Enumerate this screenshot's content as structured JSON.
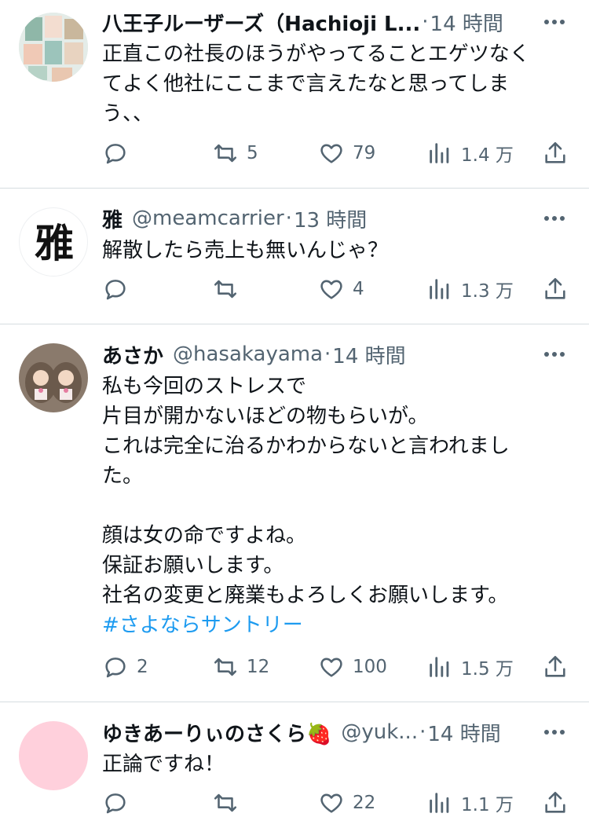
{
  "tweets": [
    {
      "name": "八王子ルーザーズ（Hachioji L...",
      "handle": "",
      "time": "14 時間",
      "lines": [
        "正直この社長のほうがやってることエゲツなく",
        "てよく他社にここまで言えたなと思ってしま",
        "う、、"
      ],
      "hashtag": "",
      "replies": "",
      "retweets": "5",
      "likes": "79",
      "views": "1.4 万",
      "avatar": "photo-collage"
    },
    {
      "name": "雅",
      "handle": "@meamcarrier",
      "time": "13 時間",
      "lines": [
        "解散したら売上も無いんじゃ？"
      ],
      "hashtag": "",
      "replies": "",
      "retweets": "",
      "likes": "4",
      "views": "1.3 万",
      "avatar_text": "雅"
    },
    {
      "name": "あさか",
      "handle": "@hasakayama",
      "time": "14 時間",
      "lines": [
        "私も今回のストレスで",
        "片目が開かないほどの物もらいが。",
        "これは完全に治るかわからないと言われまし",
        "た。",
        "",
        "顔は女の命ですよね。",
        "保証お願いします。",
        "社名の変更と廃業もよろしくお願いします。"
      ],
      "hashtag": "#さよならサントリー",
      "replies": "2",
      "retweets": "12",
      "likes": "100",
      "views": "1.5 万",
      "avatar": "plush-dolls"
    },
    {
      "name": "ゆきあーりぃのさくら🍓",
      "handle": "@yuk...",
      "time": "14 時間",
      "lines": [
        "正論ですね！"
      ],
      "hashtag": "",
      "replies": "",
      "retweets": "",
      "likes": "22",
      "views": "1.1 万",
      "avatar_color": "#ffd0dc"
    }
  ],
  "colors": {
    "text": "#0f1419",
    "muted": "#536471",
    "link": "#1d9bf0",
    "divider": "#d6dce0"
  }
}
